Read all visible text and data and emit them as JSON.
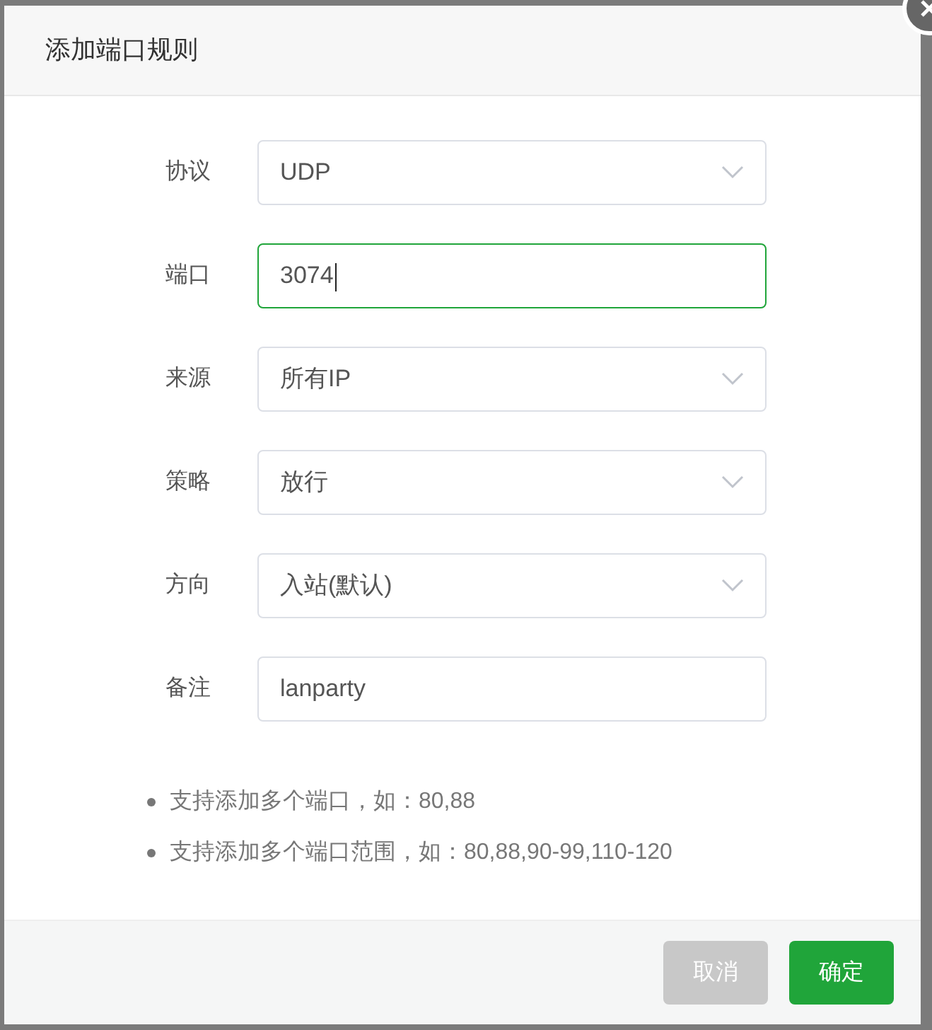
{
  "dialog": {
    "title": "添加端口规则",
    "close_button": true
  },
  "fields": [
    {
      "label": "协议",
      "kind": "select",
      "value": "UDP",
      "focused": false
    },
    {
      "label": "端口",
      "kind": "input",
      "value": "3074",
      "focused": true
    },
    {
      "label": "来源",
      "kind": "select",
      "value": "所有IP",
      "focused": false
    },
    {
      "label": "策略",
      "kind": "select",
      "value": "放行",
      "focused": false
    },
    {
      "label": "方向",
      "kind": "select",
      "value": "入站(默认)",
      "focused": false
    },
    {
      "label": "备注",
      "kind": "input",
      "value": "lanparty",
      "focused": false
    }
  ],
  "notes": [
    "支持添加多个端口，如：80,88",
    "支持添加多个端口范围，如：80,88,90-99,110-120"
  ],
  "buttons": [
    {
      "label": "取消",
      "kind": "cancel"
    },
    {
      "label": "确定",
      "kind": "primary"
    }
  ]
}
